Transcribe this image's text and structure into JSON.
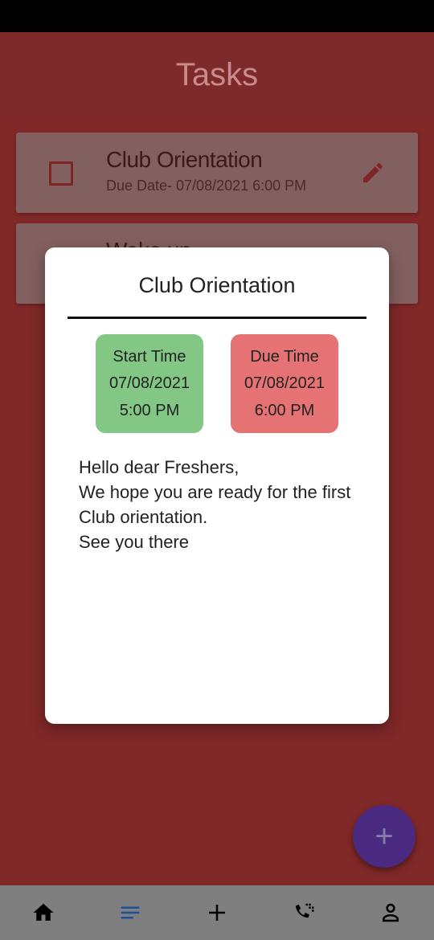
{
  "header": {
    "title": "Tasks"
  },
  "tasks": [
    {
      "title": "Club Orientation",
      "due": "Due Date- 07/08/2021 6:00 PM"
    },
    {
      "title": "Wake up",
      "due": ""
    }
  ],
  "modal": {
    "title": "Club Orientation",
    "start": {
      "label": "Start Time",
      "date": "07/08/2021",
      "time": "5:00 PM"
    },
    "due": {
      "label": "Due Time",
      "date": "07/08/2021",
      "time": "6:00 PM"
    },
    "body": [
      "Hello dear Freshers,",
      "We hope you are ready for the first",
      "Club orientation.",
      "See you there"
    ]
  },
  "fab": {
    "label": "+"
  },
  "nav": {
    "items": [
      {
        "icon": "home-icon"
      },
      {
        "icon": "list-icon"
      },
      {
        "icon": "add-icon"
      },
      {
        "icon": "call-icon"
      },
      {
        "icon": "profile-icon"
      }
    ]
  },
  "colors": {
    "start_box": "#82c784",
    "due_box": "#e57373",
    "fab": "#4a2a80",
    "active_nav": "#1a4f9c"
  }
}
